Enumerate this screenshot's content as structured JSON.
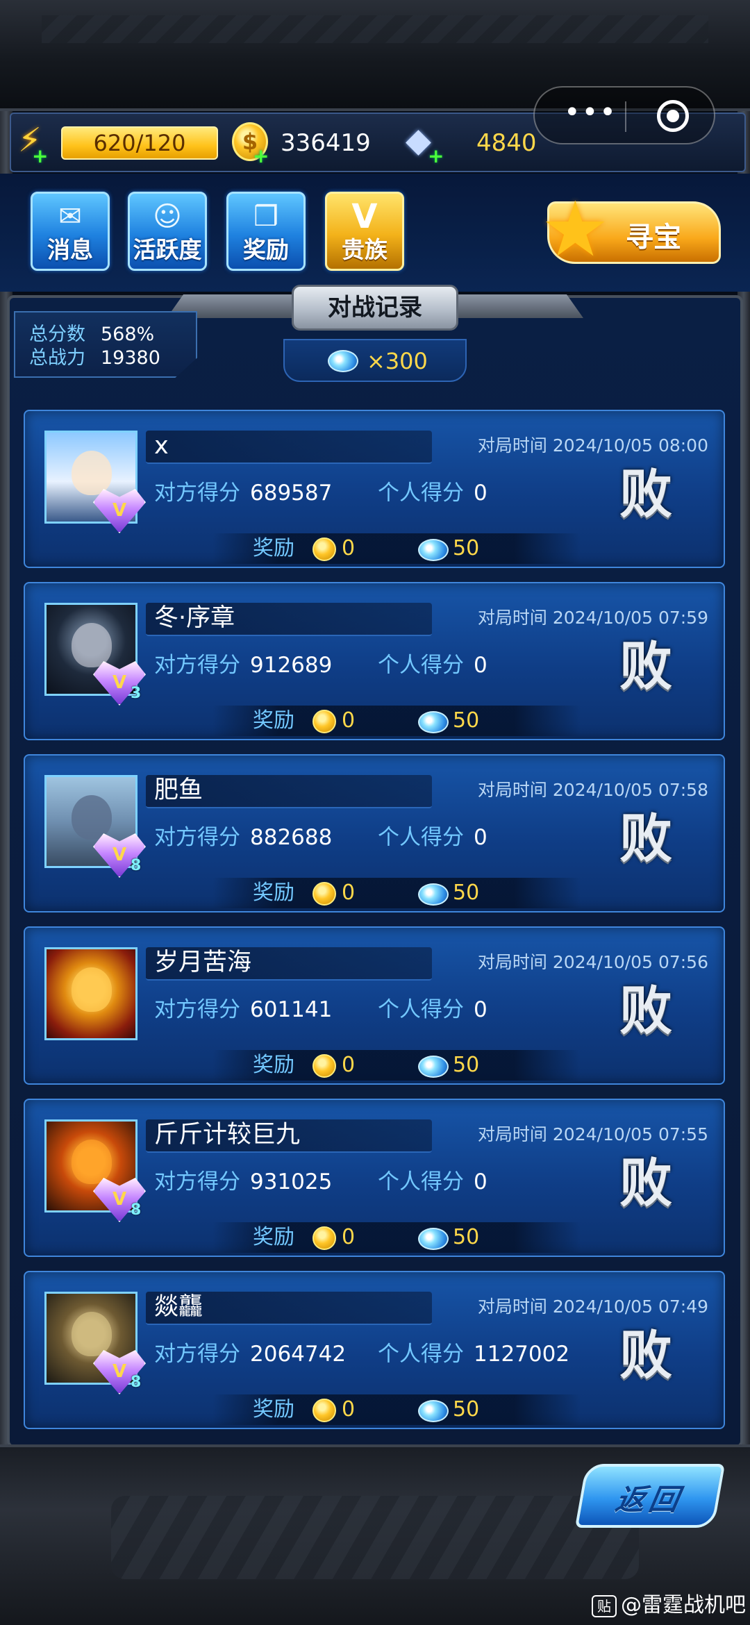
{
  "resources": {
    "energy": "620/120",
    "coins": "336419",
    "diamonds": "4840"
  },
  "menu": {
    "messages": "消息",
    "activity": "活跃度",
    "rewards": "奖励",
    "noble": "贵族",
    "treasure": "寻宝"
  },
  "panel": {
    "title": "对战记录",
    "stats": {
      "total_score_label": "总分数",
      "total_score_value": "568%",
      "total_power_label": "总战力",
      "total_power_value": "19380"
    },
    "ticket_bonus": "×300"
  },
  "labels": {
    "time": "对局时间",
    "opponent_score": "对方得分",
    "personal_score": "个人得分",
    "reward": "奖励"
  },
  "records": [
    {
      "name": "x",
      "time": "2024/10/05 08:00",
      "opponent_score": "689587",
      "personal_score": "0",
      "result": "败",
      "coin_reward": "0",
      "ticket_reward": "50",
      "vip_level": ""
    },
    {
      "name": "冬·序章",
      "time": "2024/10/05 07:59",
      "opponent_score": "912689",
      "personal_score": "0",
      "result": "败",
      "coin_reward": "0",
      "ticket_reward": "50",
      "vip_level": "3"
    },
    {
      "name": "肥鱼",
      "time": "2024/10/05 07:58",
      "opponent_score": "882688",
      "personal_score": "0",
      "result": "败",
      "coin_reward": "0",
      "ticket_reward": "50",
      "vip_level": "8"
    },
    {
      "name": "岁月苦海",
      "time": "2024/10/05 07:56",
      "opponent_score": "601141",
      "personal_score": "0",
      "result": "败",
      "coin_reward": "0",
      "ticket_reward": "50",
      "vip_level": ""
    },
    {
      "name": "斤斤计较巨九",
      "time": "2024/10/05 07:55",
      "opponent_score": "931025",
      "personal_score": "0",
      "result": "败",
      "coin_reward": "0",
      "ticket_reward": "50",
      "vip_level": "8"
    },
    {
      "name": "燚龘",
      "time": "2024/10/05 07:49",
      "opponent_score": "2064742",
      "personal_score": "1127002",
      "result": "败",
      "coin_reward": "0",
      "ticket_reward": "50",
      "vip_level": "8"
    }
  ],
  "back_button": "返回",
  "watermark": "@雷霆战机吧",
  "watermark_badge": "贴"
}
